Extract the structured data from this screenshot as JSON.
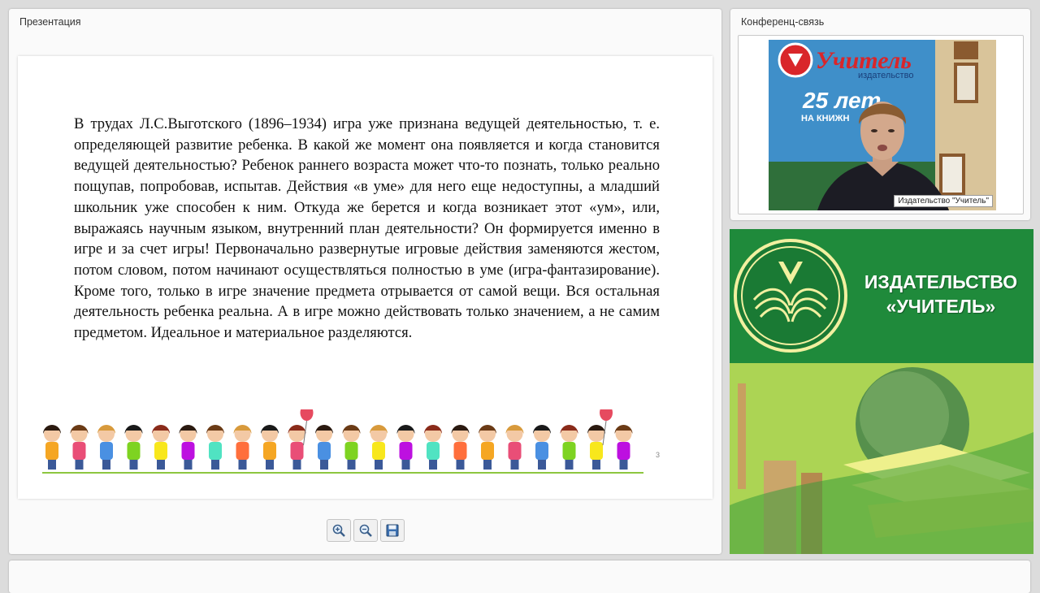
{
  "presentation": {
    "title": "Презентация",
    "slide": {
      "text": "В трудах Л.С.Выготского (1896–1934) игра уже признана ведущей деятельностью, т. е. определяющей развитие ребенка. В какой же момент она появляется и когда становится ведущей деятельностью? Ребенок раннего возраста может что-то познать, только реально пощупав, попробовав, испытав. Действия «в уме» для него еще недоступны, а младший школьник уже способен к ним. Откуда же берется и когда возникает этот «ум», или, выражаясь научным языком, внутренний план деятельности? Он формируется именно в игре и за счет игры! Первоначально развернутые игровые действия заменяются жестом, потом словом, потом начинают осуществляться полностью в уме (игра-фантазирование). Кроме того, только в игре значение предмета отрывается от самой вещи. Вся остальная деятельность ребенка реальна. А в игре можно действовать только значением, а не самим предметом. Идеальное и материальное разделяются.",
      "number": "3"
    },
    "toolbar": {
      "zoom_in_icon": "zoom-in-icon",
      "zoom_out_icon": "zoom-out-icon",
      "save_icon": "save-icon"
    }
  },
  "conference": {
    "title": "Конференц-связь",
    "speaker_label": "Издательство \"Учитель\"",
    "video_sign": {
      "brand": "Учитель",
      "sub": "издательство",
      "years": "25 лет",
      "tagline": "НА КНИЖН"
    }
  },
  "banner": {
    "line1": "ИЗДАТЕЛЬСТВО",
    "line2": "«УЧИТЕЛЬ»",
    "colors": {
      "green": "#1f8a3b",
      "light_green": "#8dc63f",
      "yellow": "#e8ef7a"
    }
  }
}
